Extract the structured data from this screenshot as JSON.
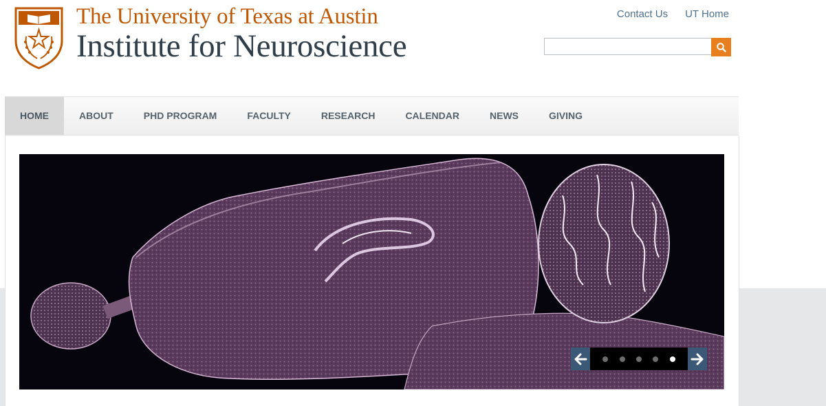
{
  "header": {
    "university_name": "The University of Texas at Austin",
    "institute_name": "Institute for Neuroscience",
    "utility_links": [
      "Contact Us",
      "UT Home"
    ],
    "search": {
      "placeholder": ""
    }
  },
  "nav": {
    "items": [
      "HOME",
      "ABOUT",
      "PHD PROGRAM",
      "FACULTY",
      "RESEARCH",
      "CALENDAR",
      "NEWS",
      "GIVING"
    ],
    "active": "HOME"
  },
  "slideshow": {
    "slide_count": 5,
    "active_slide": 5,
    "image": "sagittal-brain-section"
  },
  "colors": {
    "burnt_orange": "#bf5700",
    "slate": "#2f3e49",
    "link": "#4c6f91",
    "search_button": "#e87f1f",
    "slider_arrow": "#3b5876"
  },
  "icons": [
    "ut-shield-logo",
    "search-icon",
    "arrow-left-icon",
    "arrow-right-icon"
  ]
}
